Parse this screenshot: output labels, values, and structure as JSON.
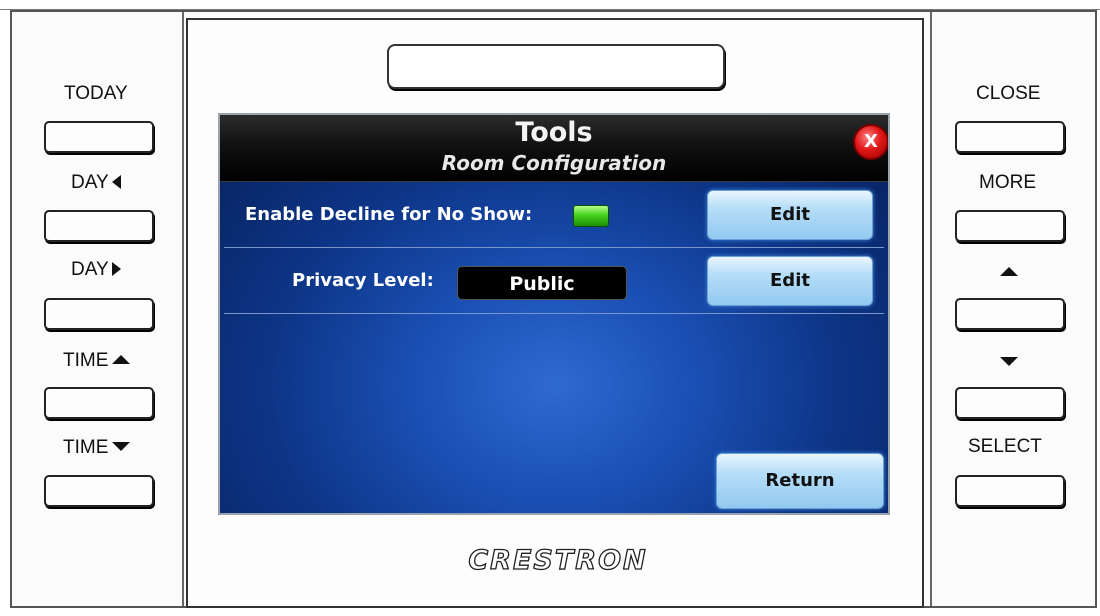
{
  "left_keys": [
    {
      "label": "TODAY",
      "arrow": "none"
    },
    {
      "label": "DAY",
      "arrow": "left-triangle-icon"
    },
    {
      "label": "DAY",
      "arrow": "right-triangle-icon"
    },
    {
      "label": "TIME",
      "arrow": "up-triangle-icon"
    },
    {
      "label": "TIME",
      "arrow": "down-triangle-icon"
    }
  ],
  "right_keys": [
    {
      "label": "CLOSE",
      "arrow": "none"
    },
    {
      "label": "MORE",
      "arrow": "none"
    },
    {
      "label": "",
      "arrow": "up-triangle-icon"
    },
    {
      "label": "",
      "arrow": "down-triangle-icon"
    },
    {
      "label": "SELECT",
      "arrow": "none"
    }
  ],
  "screen": {
    "title": "Tools",
    "subtitle": "Room Configuration",
    "close_label": "X",
    "rows": [
      {
        "label": "Enable Decline for No Show:",
        "value_type": "led",
        "led_color": "#46d21c",
        "button_label": "Edit"
      },
      {
        "label": "Privacy Level:",
        "value_type": "text",
        "value": "Public",
        "button_label": "Edit"
      }
    ],
    "return_label": "Return"
  },
  "brand": "CRESTRON",
  "colors": {
    "screen_blue": "#1a4fb3",
    "button_light_blue": "#b6def8",
    "close_red": "#e01818"
  }
}
